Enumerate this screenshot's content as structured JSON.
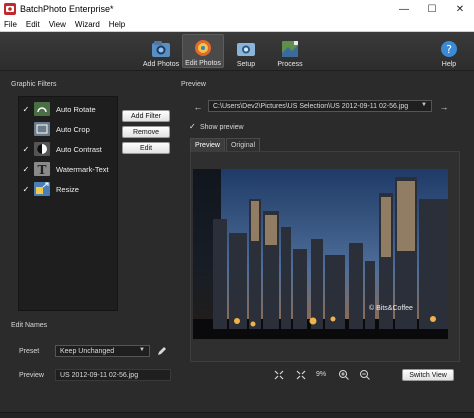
{
  "window": {
    "title": "BatchPhoto Enterprise*",
    "minimize_glyph": "—",
    "maximize_glyph": "☐",
    "close_glyph": "✕"
  },
  "menu": {
    "file": "File",
    "edit": "Edit",
    "view": "View",
    "wizard": "Wizard",
    "help": "Help"
  },
  "toolbar": {
    "add_photos": "Add Photos",
    "edit_photos": "Edit Photos",
    "setup": "Setup",
    "process": "Process",
    "help": "Help"
  },
  "graphic_filters": {
    "heading": "Graphic Filters",
    "items": [
      {
        "label": "Auto Rotate",
        "checked": "✓"
      },
      {
        "label": "Auto Crop",
        "checked": ""
      },
      {
        "label": "Auto Contrast",
        "checked": "✓"
      },
      {
        "label": "Watermark-Text",
        "checked": "✓"
      },
      {
        "label": "Resize",
        "checked": "✓"
      }
    ],
    "add_filter": "Add Filter",
    "remove": "Remove",
    "edit": "Edit"
  },
  "edit_names": {
    "heading": "Edit Names",
    "preset_label": "Preset",
    "preset_value": "Keep Unchanged",
    "preview_label": "Preview",
    "preview_value": "US 2012-09-11 02-56.jpg"
  },
  "preview": {
    "heading": "Preview",
    "path": "C:\\Users\\Dev2\\Pictures\\US Selection\\US 2012-09-11 02-56.jpg",
    "show_preview_label": "Show preview",
    "show_preview_check": "✓",
    "tab_preview": "Preview",
    "tab_original": "Original",
    "zoom_percent": "9%",
    "watermark_text": "© Bits&Coffee",
    "switch_view": "Switch View"
  },
  "colors": {
    "accent": "#4a4a4a",
    "panel": "#1e1e1e",
    "window": "#2b2b2b"
  }
}
